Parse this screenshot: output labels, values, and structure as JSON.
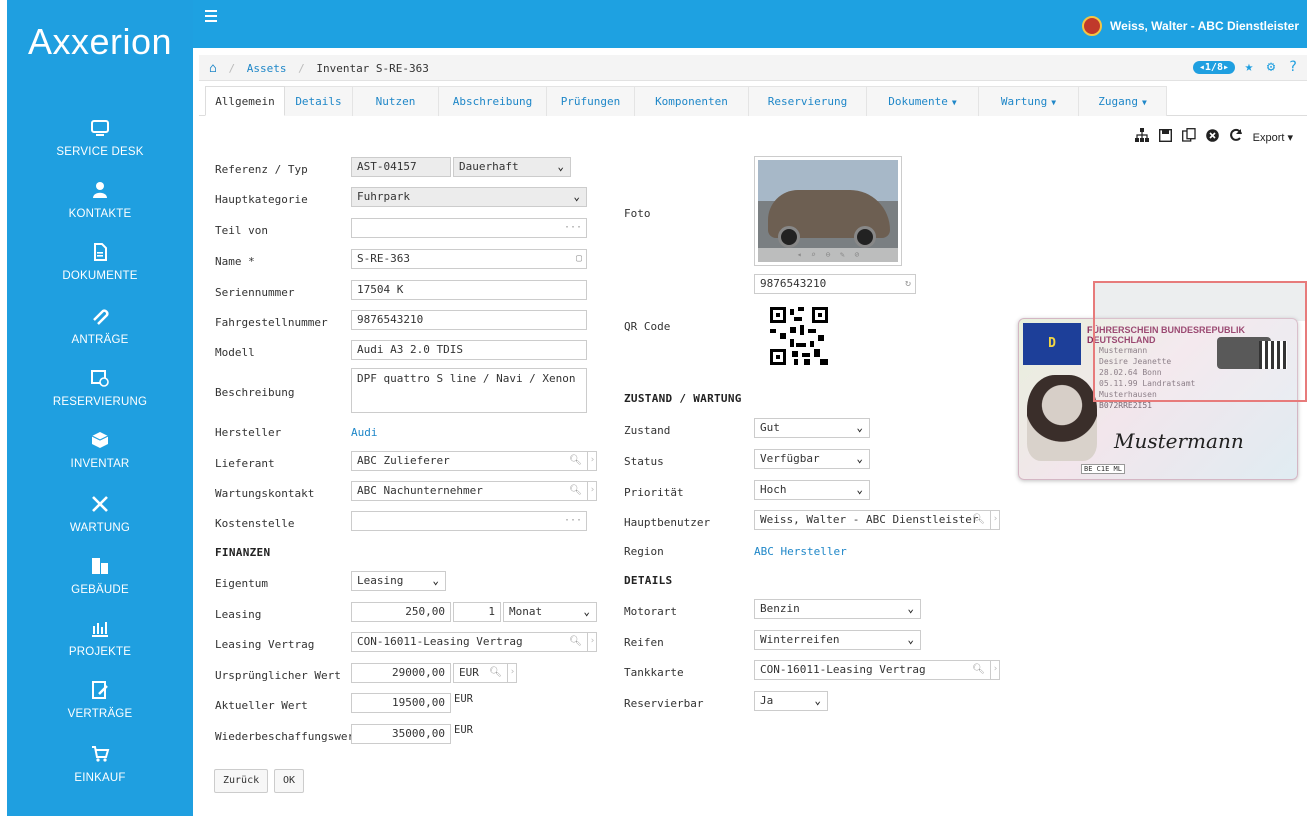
{
  "app": {
    "logo": "Axxerion"
  },
  "sidebar": {
    "items": [
      {
        "label": "SERVICE DESK",
        "icon": "monitor-icon"
      },
      {
        "label": "KONTAKTE",
        "icon": "user-icon"
      },
      {
        "label": "DOKUMENTE",
        "icon": "document-icon"
      },
      {
        "label": "ANTRÄGE",
        "icon": "paperclip-icon"
      },
      {
        "label": "RESERVIERUNG",
        "icon": "calendar-clock-icon"
      },
      {
        "label": "INVENTAR",
        "icon": "box-icon"
      },
      {
        "label": "WARTUNG",
        "icon": "tools-icon"
      },
      {
        "label": "GEBÄUDE",
        "icon": "building-icon"
      },
      {
        "label": "PROJEKTE",
        "icon": "chart-icon"
      },
      {
        "label": "VERTRÄGE",
        "icon": "contract-icon"
      },
      {
        "label": "EINKAUF",
        "icon": "cart-icon"
      }
    ]
  },
  "topbar": {
    "user": "Weiss, Walter - ABC Dienstleister"
  },
  "breadcrumb": {
    "assets": "Assets",
    "current": "Inventar S-RE-363",
    "pager": "1/8"
  },
  "tabs": [
    {
      "label": "Allgemein",
      "active": true
    },
    {
      "label": "Details"
    },
    {
      "label": "Nutzen"
    },
    {
      "label": "Abschreibung"
    },
    {
      "label": "Prüfungen"
    },
    {
      "label": "Komponenten"
    },
    {
      "label": "Reservierung"
    },
    {
      "label": "Dokumente",
      "dropdown": true
    },
    {
      "label": "Wartung",
      "dropdown": true
    },
    {
      "label": "Zugang",
      "dropdown": true
    }
  ],
  "toolbar": {
    "export": "Export"
  },
  "form": {
    "referenz_label": "Referenz / Typ",
    "referenz_value": "AST-04157",
    "typ_value": "Dauerhaft",
    "hauptkategorie_label": "Hauptkategorie",
    "hauptkategorie_value": "Fuhrpark",
    "teil_von_label": "Teil von",
    "teil_von_value": "",
    "name_label": "Name *",
    "name_value": "S-RE-363",
    "seriennummer_label": "Seriennummer",
    "seriennummer_value": "17504 K",
    "fahrgestell_label": "Fahrgestellnummer",
    "fahrgestell_value": "9876543210",
    "modell_label": "Modell",
    "modell_value": "Audi A3 2.0 TDIS",
    "beschreibung_label": "Beschreibung",
    "beschreibung_value": "DPF quattro S line / Navi / Xenon",
    "hersteller_label": "Hersteller",
    "hersteller_value": "Audi",
    "lieferant_label": "Lieferant",
    "lieferant_value": "ABC Zulieferer",
    "wartungskontakt_label": "Wartungskontakt",
    "wartungskontakt_value": "ABC Nachunternehmer",
    "kostenstelle_label": "Kostenstelle",
    "kostenstelle_value": "",
    "finanzen_title": "FINANZEN",
    "eigentum_label": "Eigentum",
    "eigentum_value": "Leasing",
    "leasing_label": "Leasing",
    "leasing_amount": "250,00",
    "leasing_qty": "1",
    "leasing_period": "Monat",
    "leasing_vertrag_label": "Leasing Vertrag",
    "leasing_vertrag_value": "CON-16011-Leasing Vertrag",
    "urspr_label": "Ursprünglicher Wert",
    "urspr_value": "29000,00",
    "urspr_currency": "EUR",
    "aktuell_label": "Aktueller Wert",
    "aktuell_value": "19500,00",
    "aktuell_unit": "EUR",
    "wieder_label": "Wiederbeschaffungswert",
    "wieder_value": "35000,00",
    "wieder_unit": "EUR",
    "foto_label": "Foto",
    "photo_code": "9876543210",
    "qr_label": "QR Code",
    "zustand_title": "ZUSTAND / WARTUNG",
    "zustand_label": "Zustand",
    "zustand_value": "Gut",
    "status_label": "Status",
    "status_value": "Verfügbar",
    "prioritaet_label": "Priorität",
    "prioritaet_value": "Hoch",
    "hauptbenutzer_label": "Hauptbenutzer",
    "hauptbenutzer_value": "Weiss, Walter - ABC Dienstleister",
    "region_label": "Region",
    "region_value": "ABC Hersteller",
    "details_title": "DETAILS",
    "motorart_label": "Motorart",
    "motorart_value": "Benzin",
    "reifen_label": "Reifen",
    "reifen_value": "Winterreifen",
    "tankkarte_label": "Tankkarte",
    "tankkarte_value": "CON-16011-Leasing Vertrag",
    "reservierbar_label": "Reservierbar",
    "reservierbar_value": "Ja"
  },
  "buttons": {
    "back": "Zurück",
    "ok": "OK"
  },
  "idcard": {
    "country": "D",
    "title": "FÜHRERSCHEIN   BUNDESREPUBLIK DEUTSCHLAND",
    "line1": "Mustermann",
    "line2": "Desire Jeanette",
    "line3": "28.02.64  Bonn",
    "line4": "05.11.99  Landratsamt",
    "line5": "Musterhausen",
    "line6": "B072RRE2I51",
    "signature": "Mustermann",
    "classes": "BE C1E ML"
  },
  "colors": {
    "brand": "#1f9fe0",
    "link": "#1f87c8"
  }
}
